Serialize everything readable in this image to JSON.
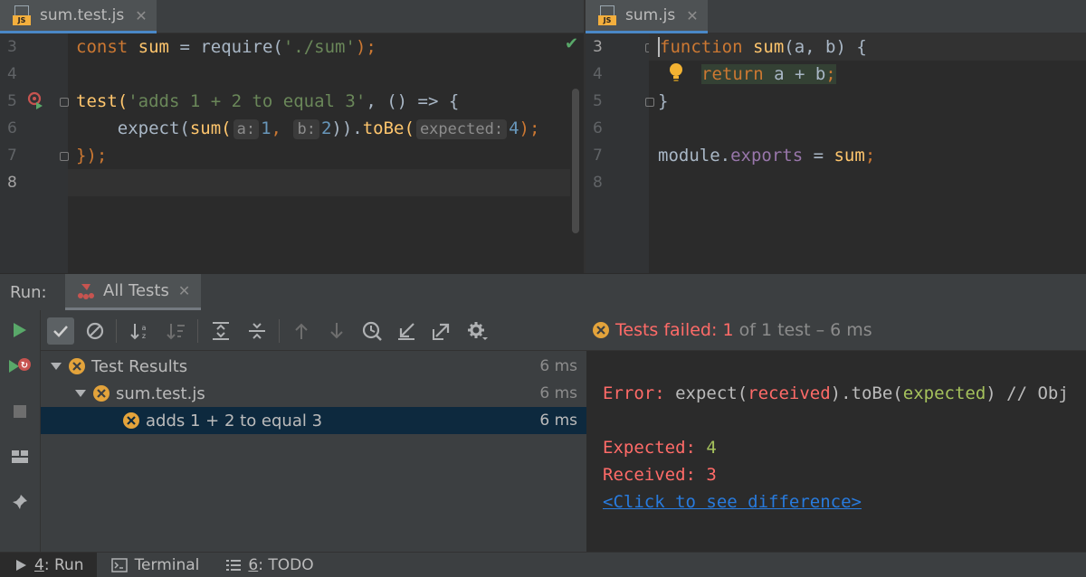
{
  "editor_left": {
    "tab": {
      "name": "sum.test.js",
      "close": "✕",
      "icon": "js-file-icon"
    },
    "line_numbers": [
      "3",
      "4",
      "5",
      "6",
      "7",
      "8"
    ],
    "lines": {
      "l3": {
        "kw": "const",
        "name": "sum",
        "eq": "=",
        "call": "require(",
        "str": "'./sum'",
        "end": ");"
      },
      "l5": {
        "fn": "test(",
        "str": "'adds 1 + 2 to equal 3'",
        "rest": ", () => {"
      },
      "l6": {
        "indent": "    ",
        "expect": "expect(",
        "fn": "sum(",
        "hint_a": "a:",
        "val_a": "1",
        "comma": ",",
        "hint_b": "b:",
        "val_b": "2",
        "close": "))",
        "dot": ".",
        "tobe": "toBe(",
        "hint_exp": "expected:",
        "val_exp": "4",
        "end": ");"
      },
      "l7": {
        "text": "});"
      }
    }
  },
  "editor_right": {
    "tab": {
      "name": "sum.js",
      "close": "✕",
      "icon": "js-file-icon"
    },
    "line_numbers": [
      "3",
      "4",
      "5",
      "6",
      "7",
      "8"
    ],
    "lines": {
      "l3": {
        "kw": "function",
        "fn": "sum",
        "rest": "(a, b) {"
      },
      "l4": {
        "kw": "return",
        "rest": "a + b",
        "semi": ";"
      },
      "l5": {
        "text": "}"
      },
      "l7": {
        "obj": "module.",
        "prop": "exports",
        "eq": " = ",
        "fn": "sum",
        "semi": ";"
      }
    }
  },
  "run_window": {
    "title": "Run:",
    "tab_label": "All Tests",
    "tab_close": "✕",
    "status": {
      "prefix": "Tests failed:",
      "failed": "1",
      "suffix": "of 1 test – 6 ms"
    },
    "tree": [
      {
        "label": "Test Results",
        "duration": "6 ms"
      },
      {
        "label": "sum.test.js",
        "duration": "6 ms"
      },
      {
        "label": "adds 1 + 2 to equal 3",
        "duration": "6 ms"
      }
    ],
    "console": {
      "error_prefix": "Error: ",
      "expect": "expect(",
      "received": "received",
      "close_tobe": ").toBe(",
      "expected": "expected",
      "tail": ") // Obj",
      "expected_label": "Expected: ",
      "expected_value": "4",
      "received_label": "Received: ",
      "received_value": "3",
      "diff_link": "<Click to see difference>"
    }
  },
  "bottom_bar": {
    "run": {
      "num": "4",
      "label": ": Run"
    },
    "terminal": {
      "label": "Terminal"
    },
    "todo": {
      "num": "6",
      "label": ": TODO"
    }
  },
  "colors": {
    "keyword": "#cc7832",
    "string": "#6a8759",
    "function": "#ffc66d",
    "number": "#6897bb",
    "error": "#ff6b68",
    "success": "#a5c25c",
    "link": "#287bde",
    "selection": "#0d293e",
    "fail_icon": "#e3a33b"
  }
}
